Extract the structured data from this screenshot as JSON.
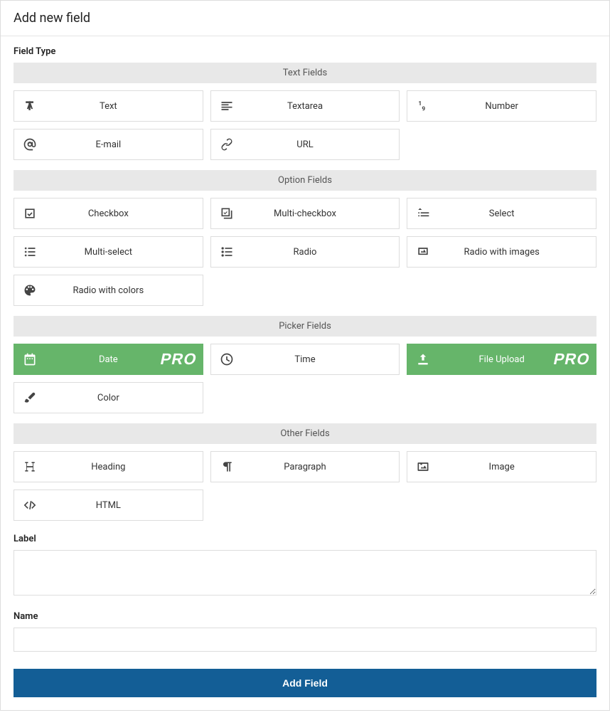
{
  "title": "Add new field",
  "fieldTypeLabel": "Field Type",
  "proBadge": "PRO",
  "groups": {
    "text": {
      "header": "Text Fields",
      "items": [
        {
          "label": "Text"
        },
        {
          "label": "Textarea"
        },
        {
          "label": "Number"
        },
        {
          "label": "E-mail"
        },
        {
          "label": "URL"
        }
      ]
    },
    "option": {
      "header": "Option Fields",
      "items": [
        {
          "label": "Checkbox"
        },
        {
          "label": "Multi-checkbox"
        },
        {
          "label": "Select"
        },
        {
          "label": "Multi-select"
        },
        {
          "label": "Radio"
        },
        {
          "label": "Radio with images"
        },
        {
          "label": "Radio with colors"
        }
      ]
    },
    "picker": {
      "header": "Picker Fields",
      "items": [
        {
          "label": "Date"
        },
        {
          "label": "Time"
        },
        {
          "label": "File Upload"
        },
        {
          "label": "Color"
        }
      ]
    },
    "other": {
      "header": "Other Fields",
      "items": [
        {
          "label": "Heading"
        },
        {
          "label": "Paragraph"
        },
        {
          "label": "Image"
        },
        {
          "label": "HTML"
        }
      ]
    }
  },
  "labelLabel": "Label",
  "labelValue": "",
  "nameLabel": "Name",
  "nameValue": "",
  "submitLabel": "Add Field"
}
